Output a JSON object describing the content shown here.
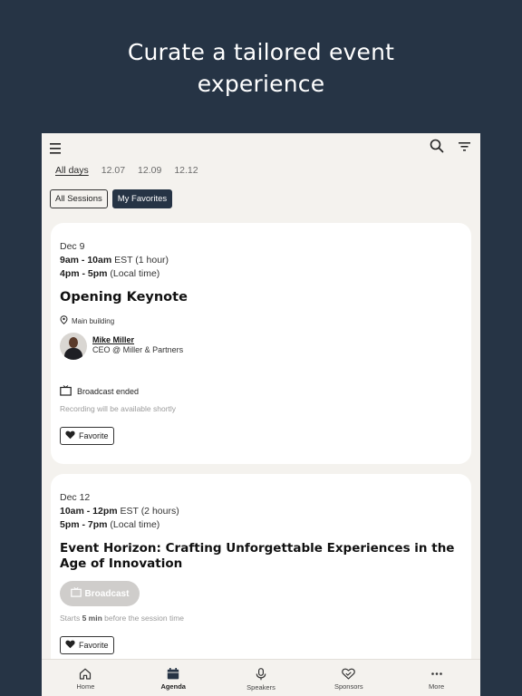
{
  "hero": {
    "line1": "Curate a tailored event",
    "line2": "experience"
  },
  "day_tabs": [
    {
      "label": "All days",
      "active": true
    },
    {
      "label": "12.07"
    },
    {
      "label": "12.09"
    },
    {
      "label": "12.12"
    }
  ],
  "filters": {
    "all_sessions": "All Sessions",
    "my_favorites": "My Favorites"
  },
  "sessions": [
    {
      "date": "Dec 9",
      "time_est": "9am - 10am",
      "tz_est": " EST (1 hour)",
      "time_local": "4pm - 5pm",
      "tz_local": " (Local time)",
      "title": "Opening Keynote",
      "location": "Main building",
      "speaker_name": "Mike  Miller",
      "speaker_role": "CEO @ Miller & Partners",
      "broadcast_status": "Broadcast ended",
      "broadcast_note": "Recording will be available shortly",
      "favorite_label": "Favorite"
    },
    {
      "date": "Dec 12",
      "time_est": "10am - 12pm",
      "tz_est": " EST (2 hours)",
      "time_local": "5pm - 7pm",
      "tz_local": " (Local time)",
      "title_line1": "Event Horizon: Crafting Unforgettable Experiences in the",
      "title_line2": "Age of Innovation",
      "broadcast_label": "Broadcast",
      "starts_prefix": "Starts ",
      "starts_bold": "5 min",
      "starts_suffix": " before the session time",
      "favorite_label": "Favorite"
    }
  ],
  "nav": [
    {
      "label": "Home",
      "icon": "home-icon"
    },
    {
      "label": "Agenda",
      "icon": "calendar-icon",
      "active": true
    },
    {
      "label": "Speakers",
      "icon": "microphone-icon"
    },
    {
      "label": "Sponsors",
      "icon": "handshake-heart-icon"
    },
    {
      "label": "More",
      "icon": "more-icon"
    }
  ],
  "colors": {
    "background": "#263445",
    "screen": "#f4f2ee",
    "card": "#ffffff",
    "accent": "#263445",
    "disabled": "#cfcdcb"
  }
}
